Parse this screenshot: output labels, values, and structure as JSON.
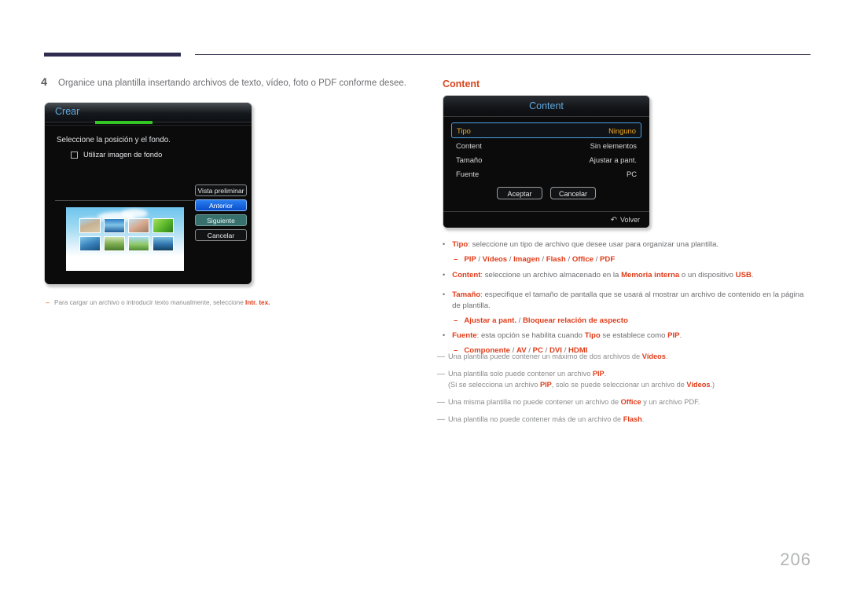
{
  "page": {
    "number": "206"
  },
  "step": {
    "number": "4",
    "text": "Organice una plantilla insertando archivos de texto, vídeo, foto o PDF conforme desee."
  },
  "crear_dialog": {
    "title": "Crear",
    "instruction": "Seleccione la posición y el fondo.",
    "checkbox_label": "Utilizar imagen de fondo",
    "buttons": [
      {
        "label": "Vista preliminar",
        "state": "normal"
      },
      {
        "label": "Anterior",
        "state": "focused"
      },
      {
        "label": "Siguiente",
        "state": "selected"
      },
      {
        "label": "Cancelar",
        "state": "normal"
      }
    ]
  },
  "crear_note": {
    "dash": "–",
    "text_before": "Para cargar un archivo o introducir texto manualmente, seleccione ",
    "bold": "Intr. tex."
  },
  "content_section": {
    "heading": "Content",
    "dialog": {
      "title": "Content",
      "rows": [
        {
          "key": "Tipo",
          "value": "Ninguno",
          "active": true
        },
        {
          "key": "Content",
          "value": "Sin elementos",
          "active": false
        },
        {
          "key": "Tamaño",
          "value": "Ajustar a pant.",
          "active": false
        },
        {
          "key": "Fuente",
          "value": "PC",
          "active": false
        }
      ],
      "accept_label": "Aceptar",
      "cancel_label": "Cancelar",
      "return_icon": "↶",
      "return_label": "Volver"
    },
    "bullets": [
      {
        "dot": "•",
        "lead": "Tipo",
        "rest": ": seleccione un tipo de archivo que desee usar para organizar una plantilla.",
        "sub": {
          "dash": "–",
          "text": "PIP / Vídeos / Imagen / Flash / Office / PDF"
        }
      },
      {
        "dot": "•",
        "lead": "Content",
        "rest": ": seleccione un archivo almacenado en la Memoria interna o un dispositivo USB.",
        "sub": null
      },
      {
        "dot": "•",
        "lead": "Tamaño",
        "rest": ": especifique el tamaño de pantalla que se usará al mostrar un archivo de contenido en la página de plantilla.",
        "sub": {
          "dash": "–",
          "text": "Ajustar a pant. / Bloquear relación de aspecto"
        }
      },
      {
        "dot": "•",
        "lead": "Fuente",
        "rest": ": esta opción se habilita cuando Tipo se establece como PIP.",
        "sub": {
          "dash": "–",
          "text": "Componente / AV / PC / DVI / HDMI"
        }
      }
    ],
    "notes": [
      {
        "dash": "—",
        "text": "Una plantilla puede contener un máximo de dos archivos de Vídeos.",
        "line2": null
      },
      {
        "dash": "—",
        "text": "Una plantilla solo puede contener un archivo PIP.",
        "line2": "(Si se selecciona un archivo PIP, solo se puede seleccionar un archivo de Vídeos.)"
      },
      {
        "dash": "—",
        "text": "Una misma plantilla no puede contener un archivo de Office y un archivo PDF.",
        "line2": null
      },
      {
        "dash": "—",
        "text": "Una plantilla no puede contener más de un archivo de Flash.",
        "line2": null
      }
    ]
  },
  "colors": {
    "accent_red": "#e03c1a",
    "heading_red": "#d8461b",
    "osd_blue": "#5fa9e0",
    "osd_amber": "#f2a922",
    "osd_green": "#34c724",
    "focus_blue": "#2a7ff0",
    "selected_teal": "#38706d",
    "header_navy": "#2e2d4f",
    "body_gray": "#6d6e71"
  }
}
